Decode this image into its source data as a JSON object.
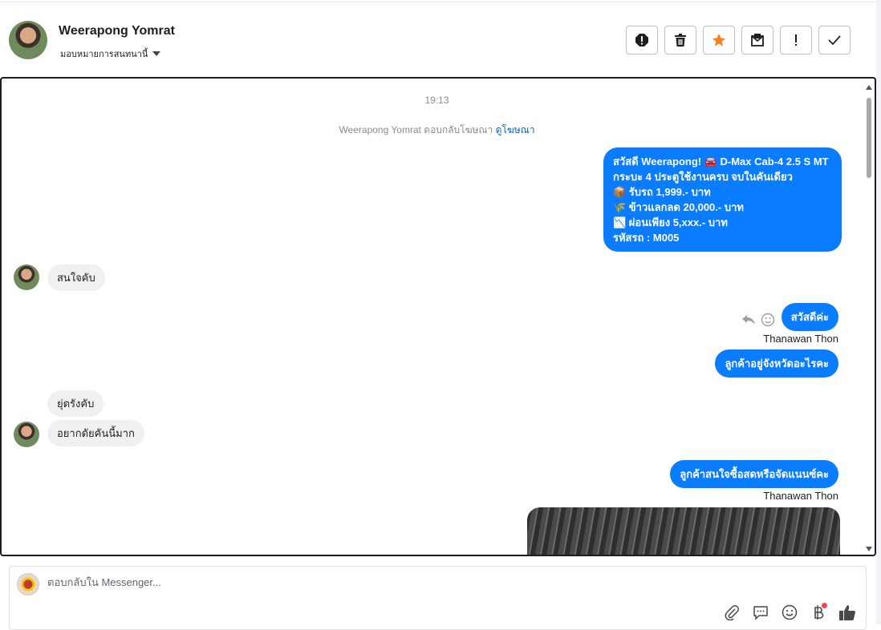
{
  "header": {
    "name": "Weerapong Yomrat",
    "assign_label": "มอบหมายการสนทนานี้"
  },
  "conversation": {
    "timestamp": "19:13",
    "ad_notice": "Weerapong Yomrat ตอบกลับโฆษณา",
    "ad_link": "ดูโฆษณา",
    "promo_lines": [
      "สวัสดี Weerapong! 🚘 D-Max Cab-4 2.5 S MT",
      "กระบะ 4 ประตูใช้งานครบ จบในคันเดียว",
      "📦 รับรถ 1,999.- บาท",
      "🌾 ข้าวแลกลด 20,000.- บาท",
      "📉 ผ่อนเพียง 5,xxx.- บาท",
      "รหัสรถ : M005"
    ],
    "msg_interested": "สนใจคับ",
    "msg_hello": "สวัสดีค่ะ",
    "sender_1": "Thanawan Thon",
    "msg_province_q": "ลูกค้าอยู่จังหวัดอะไรคะ",
    "msg_province_a": "ยุ่ตรังคับ",
    "msg_want": "อยากดัยคันนี้มาก",
    "msg_payment_q": "ลูกค้าสนใจซื้อสดหรือจัดแนนซ์คะ",
    "sender_2": "Thanawan Thon"
  },
  "composer": {
    "placeholder": "ตอบกลับใน Messenger..."
  },
  "colors": {
    "outgoing_bubble": "#0a7cff",
    "incoming_bubble": "#f0f0f0",
    "star_accent": "#f5821f",
    "ad_link": "#0064d1"
  }
}
